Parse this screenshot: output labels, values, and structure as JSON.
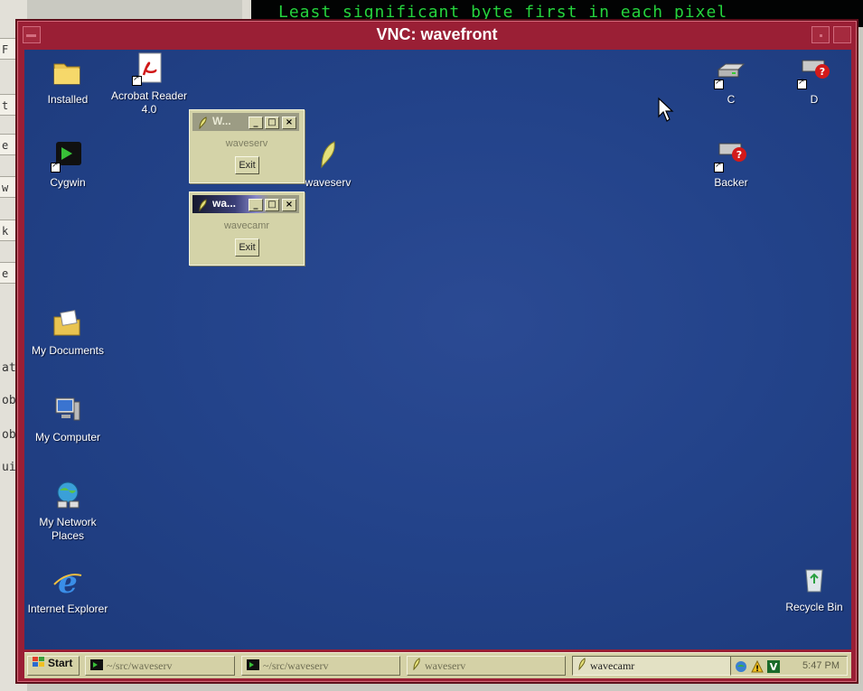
{
  "background": {
    "terminal_text": "Least significant byte first in each pixel",
    "edge_fragments": [
      "F",
      "t",
      "e",
      "w",
      "k",
      "e"
    ],
    "edge_text": [
      "at",
      "ob",
      "ob",
      "ui"
    ]
  },
  "vnc": {
    "title": "VNC: wavefront"
  },
  "desktop": {
    "icons": {
      "installed": "Installed",
      "acrobat": "Acrobat Reader 4.0",
      "cygwin": "Cygwin",
      "waveserv": "waveserv",
      "drive_c": "C",
      "drive_d": "D",
      "backer": "Backer",
      "my_documents": "My Documents",
      "my_computer": "My Computer",
      "my_network": "My Network Places",
      "internet_explorer": "Internet Explorer",
      "recycle_bin": "Recycle Bin"
    }
  },
  "windows": {
    "waveserv": {
      "title": "W...",
      "label": "waveserv",
      "exit": "Exit"
    },
    "wavecamr": {
      "title": "wa...",
      "label": "wavecamr",
      "exit": "Exit"
    }
  },
  "taskbar": {
    "start": "Start",
    "buttons": [
      "~/src/waveserv",
      "~/src/waveserv",
      "waveserv",
      "wavecamr"
    ],
    "clock": "5:47 PM"
  },
  "colors": {
    "desktop_blue": "#23438a",
    "vnc_frame": "#9a1f35",
    "terminal_green": "#25d33d",
    "taskbar": "#d4d1a6"
  }
}
